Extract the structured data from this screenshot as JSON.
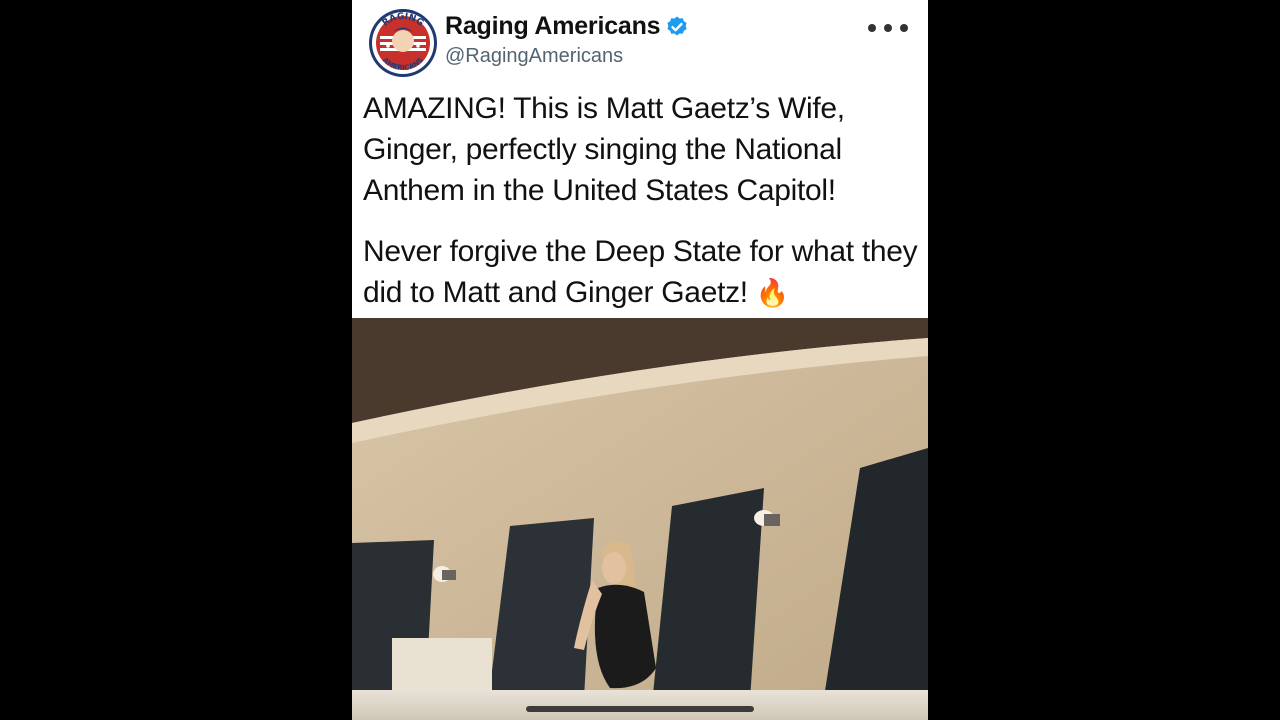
{
  "tweet": {
    "display_name": "Raging Americans",
    "handle": "@RagingAmericans",
    "verified_icon": "verified-badge-icon",
    "avatar_text_top": "RAGING",
    "avatar_text_bottom": "AMERICANS",
    "text_paragraphs": [
      "AMAZING! This is Matt Gaetz’s Wife, Ginger, perfectly singing the National Anthem in the United States Capitol!",
      "Never forgive the Deep State for what they did to Matt and Ginger Gaetz!"
    ],
    "emoji": "🔥",
    "more_icon": "more-options-icon"
  },
  "colors": {
    "background": "#000000",
    "card": "#ffffff",
    "verified": "#1d9bf0",
    "handle": "#536471"
  }
}
